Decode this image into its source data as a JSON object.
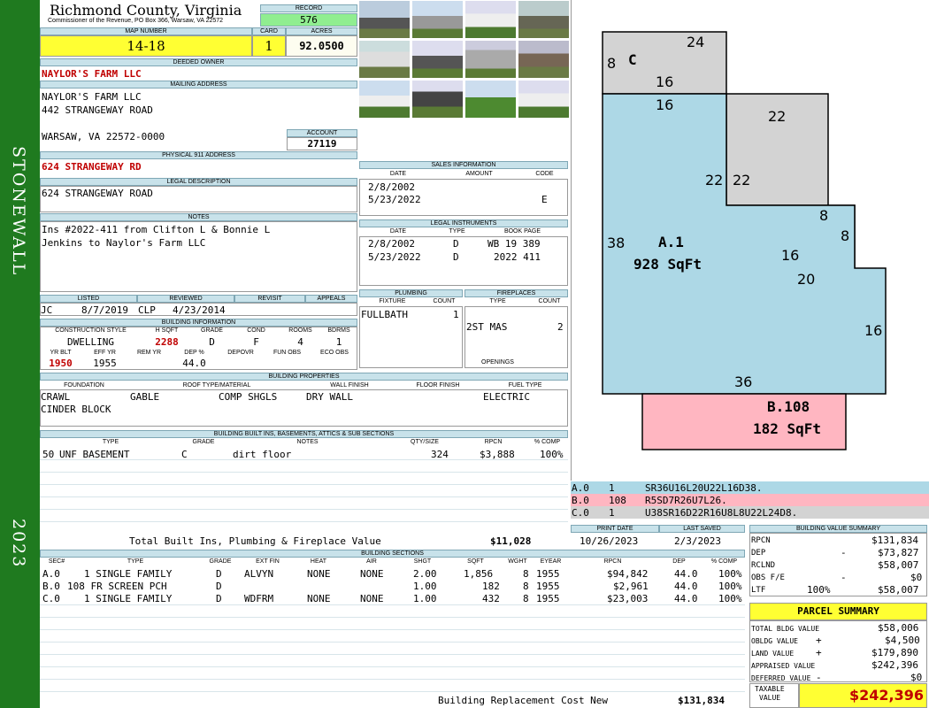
{
  "sidebar": {
    "district": "STONEWALL",
    "year": "2023"
  },
  "header": {
    "county": "Richmond County, Virginia",
    "subtitle": "Commissioner of the Revenue, PO Box 366, Warsaw, VA 22572",
    "record_label": "RECORD",
    "record": "576",
    "map_label": "MAP NUMBER",
    "map": "14-18",
    "card_label": "CARD",
    "card": "1",
    "acres_label": "ACRES",
    "acres": "92.0500"
  },
  "owner": {
    "label": "DEEDED OWNER",
    "name": "NAYLOR'S FARM LLC"
  },
  "mailing": {
    "label": "MAILING ADDRESS",
    "line1": "NAYLOR'S FARM LLC",
    "line2": "442 STRANGEWAY ROAD",
    "line3": "WARSAW, VA 22572-0000",
    "account_label": "ACCOUNT",
    "account": "27119"
  },
  "physical": {
    "label": "PHYSICAL 911 ADDRESS",
    "address": "624 STRANGEWAY RD"
  },
  "legal": {
    "label": "LEGAL DESCRIPTION",
    "text": "624 STRANGEWAY ROAD"
  },
  "notes": {
    "label": "NOTES",
    "line1": "Ins #2022-411 from Clifton L & Bonnie L",
    "line2": "Jenkins to Naylor's Farm LLC"
  },
  "dates": {
    "listed_label": "LISTED",
    "reviewed_label": "REVIEWED",
    "revisit_label": "REVISIT",
    "appeals_label": "APPEALS",
    "listed_by": "JC",
    "listed": "8/7/2019",
    "reviewed_by": "CLP",
    "reviewed": "4/23/2014"
  },
  "building": {
    "label": "BUILDING INFORMATION",
    "h_style": "CONSTRUCTION STYLE",
    "h_sqft": "H SQFT",
    "h_grade": "GRADE",
    "h_cond": "COND",
    "h_rooms": "ROOMS",
    "h_bdrms": "BDRMS",
    "style": "DWELLING",
    "sqft": "2288",
    "grade": "D",
    "cond": "F",
    "rooms": "4",
    "bdrms": "1",
    "h_yrblt": "YR BLT",
    "h_effyr": "EFF YR",
    "h_remyr": "REM YR",
    "h_dep": "DEP %",
    "h_depovr": "DEPOVR",
    "h_funobs": "FUN OBS",
    "h_ecoobs": "ECO OBS",
    "yrblt": "1950",
    "effyr": "1955",
    "dep": "44.0"
  },
  "sales": {
    "label": "SALES INFORMATION",
    "h_date": "DATE",
    "h_amount": "AMOUNT",
    "h_code": "CODE",
    "rows": [
      {
        "date": "2/8/2002",
        "code": ""
      },
      {
        "date": "5/23/2022",
        "code": "E"
      }
    ]
  },
  "instruments": {
    "label": "LEGAL INSTRUMENTS",
    "h_date": "DATE",
    "h_type": "TYPE",
    "h_book": "BOOK PAGE",
    "rows": [
      {
        "date": "2/8/2002",
        "type": "D",
        "book": "WB 19 389"
      },
      {
        "date": "5/23/2022",
        "type": "D",
        "book": "2022 411"
      }
    ]
  },
  "plumbing": {
    "label": "PLUMBING",
    "h_fixture": "FIXTURE",
    "h_count": "COUNT",
    "fixture": "FULLBATH",
    "count": "1"
  },
  "fireplaces": {
    "label": "FIREPLACES",
    "h_type": "TYPE",
    "h_count": "COUNT",
    "type": "2ST MAS",
    "count": "2",
    "openings": "OPENINGS"
  },
  "properties": {
    "label": "BUILDING PROPERTIES",
    "h_foundation": "FOUNDATION",
    "h_roof": "ROOF TYPE/MATERIAL",
    "h_wall": "WALL FINISH",
    "h_floor": "FLOOR FINISH",
    "h_fuel": "FUEL TYPE",
    "foundation1": "CRAWL",
    "foundation2": "CINDER BLOCK",
    "roof_type": "GABLE",
    "roof_mat": "COMP SHGLS",
    "wall": "DRY WALL",
    "fuel": "ELECTRIC"
  },
  "builtins": {
    "label": "BUILDING BUILT INS, BASEMENTS, ATTICS & SUB SECTIONS",
    "h_type": "TYPE",
    "h_grade": "GRADE",
    "h_notes": "NOTES",
    "h_qty": "QTY/SIZE",
    "h_rpcn": "RPCN",
    "h_comp": "% COMP",
    "code": "50",
    "type": "UNF BASEMENT",
    "grade": "C",
    "notes": "dirt floor",
    "qty": "324",
    "rpcn": "$3,888",
    "comp": "100%",
    "total_label": "Total Built Ins, Plumbing & Fireplace Value",
    "total": "$11,028"
  },
  "sections": {
    "label": "BUILDING SECTIONS",
    "h": [
      "SEC#",
      "TYPE",
      "GRADE",
      "EXT FIN",
      "HEAT",
      "AIR",
      "SHGT",
      "SQFT",
      "WGHT",
      "EYEAR",
      "RPCN",
      "DEP",
      "% COMP"
    ],
    "rows": [
      {
        "sec": "A.0",
        "type": "1 SINGLE FAMILY",
        "grade": "D",
        "ext": "ALVYN",
        "heat": "NONE",
        "air": "NONE",
        "shgt": "2.00",
        "sqft": "1,856",
        "wght": "8",
        "eyear": "1955",
        "rpcn": "$94,842",
        "dep": "44.0",
        "comp": "100%"
      },
      {
        "sec": "B.0",
        "type": "108 FR SCREEN PCH",
        "grade": "D",
        "ext": "",
        "heat": "",
        "air": "",
        "shgt": "1.00",
        "sqft": "182",
        "wght": "8",
        "eyear": "1955",
        "rpcn": "$2,961",
        "dep": "44.0",
        "comp": "100%"
      },
      {
        "sec": "C.0",
        "type": "1 SINGLE FAMILY",
        "grade": "D",
        "ext": "WDFRM",
        "heat": "NONE",
        "air": "NONE",
        "shgt": "1.00",
        "sqft": "432",
        "wght": "8",
        "eyear": "1955",
        "rpcn": "$23,003",
        "dep": "44.0",
        "comp": "100%"
      }
    ],
    "replacement_label": "Building Replacement Cost New",
    "replacement": "$131,834"
  },
  "sketch": {
    "area_a_label": "A.1",
    "area_a_sqft": "928 SqFt",
    "area_b_label": "B.108",
    "area_b_sqft": "182 SqFt",
    "area_c_label": "C",
    "dims": [
      "24",
      "8",
      "16",
      "16",
      "22",
      "22",
      "22",
      "8",
      "8",
      "38",
      "16",
      "20",
      "16",
      "36"
    ],
    "color_a": "#add8e6",
    "color_b": "#ffb6c1",
    "color_c": "#d3d3d3"
  },
  "vectors": [
    {
      "sec": "A.0",
      "num": "1",
      "code": "SR36U16L20U22L16D38.",
      "color": "#add8e6"
    },
    {
      "sec": "B.0",
      "num": "108",
      "code": "R5SD7R26U7L26.",
      "color": "#ffb6c1"
    },
    {
      "sec": "C.0",
      "num": "1",
      "code": "U38SR16D22R16U8L8U22L24D8.",
      "color": "#d3d3d3"
    }
  ],
  "print": {
    "date_label": "PRINT DATE",
    "saved_label": "LAST SAVED",
    "date": "10/26/2023",
    "saved": "2/3/2023"
  },
  "summary": {
    "label": "BUILDING VALUE SUMMARY",
    "rpcn_label": "RPCN",
    "rpcn": "$131,834",
    "dep_label": "DEP",
    "dep_sign": "-",
    "dep": "$73,827",
    "rclnd_label": "RCLND",
    "rclnd": "$58,007",
    "obs_label": "OBS F/E",
    "obs_sign": "-",
    "obs": "$0",
    "ltf_label": "LTF",
    "ltf_pct": "100%",
    "ltf": "$58,007"
  },
  "parcel": {
    "label": "PARCEL SUMMARY",
    "bldg_label": "TOTAL BLDG VALUE",
    "bldg": "$58,006",
    "obldg_label": "OBLDG VALUE",
    "obldg_sign": "+",
    "obldg": "$4,500",
    "land_label": "LAND VALUE",
    "land_sign": "+",
    "land": "$179,890",
    "appraised_label": "APPRAISED VALUE",
    "appraised": "$242,396",
    "deferred_label": "DEFERRED VALUE",
    "deferred_sign": "-",
    "deferred": "$0",
    "taxable_label1": "TAXABLE",
    "taxable_label2": "VALUE",
    "taxable": "$242,396"
  }
}
